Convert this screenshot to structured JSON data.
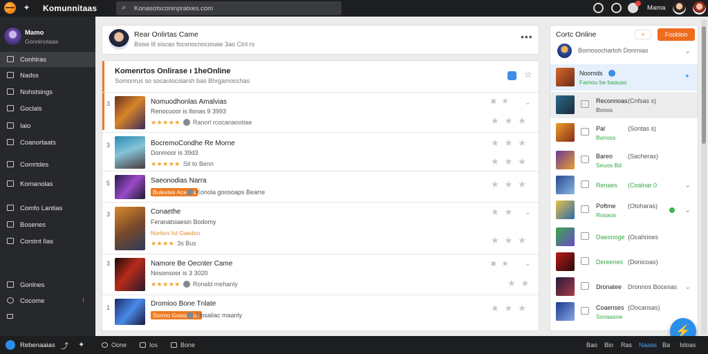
{
  "topbar": {
    "app_title": "Komunnitaas",
    "search_placeholder": "Konasotsconinpratxes.com",
    "user_name": "Mama",
    "notification_color": "#e8413a"
  },
  "sidebar": {
    "user": {
      "name": "Mamo",
      "subtitle": "Gonninotaas"
    },
    "items": [
      {
        "label": "Conhlras",
        "icon": "grid-icon",
        "active": true
      },
      {
        "label": "Nadss",
        "icon": "list-icon"
      },
      {
        "label": "Nohstsings",
        "icon": "chat-icon"
      },
      {
        "label": "Goclals",
        "icon": "wrench-icon"
      },
      {
        "label": "Iaio",
        "icon": "stack-icon"
      },
      {
        "label": "Coanortaats",
        "icon": "folder-icon"
      },
      {
        "label": "Comrtdes",
        "icon": "calendar-icon"
      },
      {
        "label": "Komanolas",
        "icon": "media-icon"
      },
      {
        "label": "Comfo Lantias",
        "icon": "bookmark-icon"
      },
      {
        "label": "Bosenes",
        "icon": "image-icon"
      },
      {
        "label": "Corstnt Ilas",
        "icon": "file-icon"
      },
      {
        "label": "Gonlnes",
        "icon": "chart-icon"
      },
      {
        "label": "Cocome",
        "icon": "globe-icon"
      }
    ]
  },
  "composer": {
    "title": "Rear Onlirtas Came",
    "subtitle": "Bsise Ill siscas focsnocnocooaie 3ao Cinl rs"
  },
  "list": {
    "title": "Komenrtos Onlirase ı 1heOnline",
    "subtitle": "Somonrus so socanlocolarsh bas Bhrgamocchas",
    "games": [
      {
        "rank": "3",
        "title": "Nomuodhonlas Amalvias",
        "sub": "Renocuoor is llonas 9 3993",
        "rating": "★★★★★",
        "meta": "Ranorl rcocanaootiae",
        "tag": ""
      },
      {
        "rank": "3",
        "title": "BocremoCondhe Re Morne",
        "sub": "Donmoor is 39d3",
        "rating": "★★★★★",
        "meta": "Sit to Benn",
        "tag": ""
      },
      {
        "rank": "5",
        "title": "Saeonodias Narra",
        "sub": "",
        "rating": "",
        "meta": "Konola goosoaps Bearre",
        "tag": "Bulestes Acecas"
      },
      {
        "rank": "3",
        "title": "Conaethe",
        "sub": "Feranatsiaesin Bodomy",
        "sub2": "Nortsrs Ist Gaedon",
        "rating": "★★★★",
        "meta": "3s Bus",
        "tag": ""
      },
      {
        "rank": "3",
        "title": "Namore Be Oecnter Came",
        "sub": "Nosonsoor is 3 3020",
        "rating": "★★★★★",
        "meta": "Ronald mehanly",
        "tag": ""
      },
      {
        "rank": "1",
        "title": "Dromioo Bone Tnlate",
        "sub": "",
        "rating": "",
        "meta": "Nosaliac maanly",
        "tag": "Sormo Gosoaslua"
      }
    ]
  },
  "right_panel": {
    "title": "Cortc Online",
    "chip": "+",
    "button": "Fooblon",
    "subtitle": "Bomosochartoh Donrnias",
    "friends": [
      {
        "name": "Noomds",
        "status": "Famou be baauas",
        "mid": "",
        "style": "hl"
      },
      {
        "name": "Reconnoas",
        "status": "Bonos",
        "mid": "(Cnfsas s)",
        "style": "gray"
      },
      {
        "name": "Pal",
        "status": "Banoss",
        "mid": "(Sontas s)",
        "style": ""
      },
      {
        "name": "Bareo",
        "status": "Seuos Bd",
        "mid": "(Sacheras)",
        "style": ""
      },
      {
        "name": "Renaes",
        "status": "",
        "mid": "(Coalnar 0",
        "style": ""
      },
      {
        "name": "Poftme",
        "status": "Rosaos",
        "mid": "(Otoharas)",
        "style": ""
      },
      {
        "name": "Daeonoge",
        "status": "",
        "mid": "(Ocahrioes",
        "style": ""
      },
      {
        "name": "Dereenes",
        "status": "",
        "mid": "(Donicoas)",
        "style": ""
      },
      {
        "name": "Dronatee",
        "status": "",
        "mid": "Dronnos Bocesas",
        "style": ""
      },
      {
        "name": "Coaenses",
        "status": "Sonaasoe",
        "mid": "(Oocansas)",
        "style": ""
      }
    ]
  },
  "bottombar": {
    "user": "Rebenaaias",
    "items": [
      "Oone",
      "Ios",
      "Bone"
    ],
    "right": [
      "Bao",
      "Bio",
      "Ras",
      "Naaas",
      "Ba",
      "Isloas"
    ]
  }
}
